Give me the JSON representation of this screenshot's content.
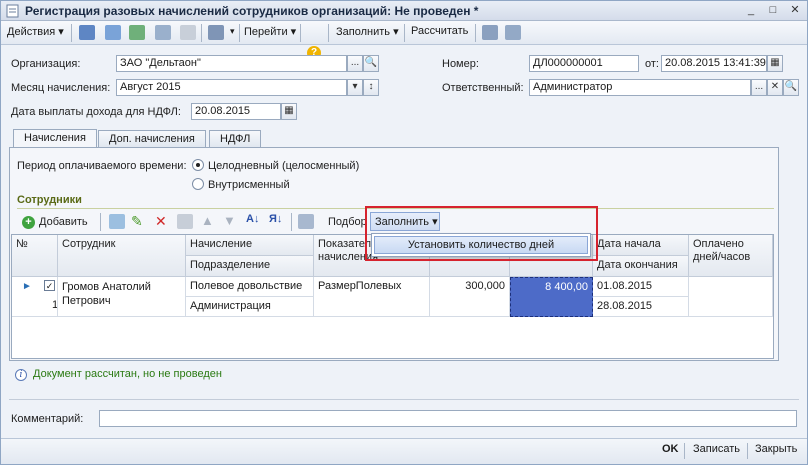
{
  "window": {
    "title": "Регистрация разовых начислений сотрудников организаций: Не проведен *"
  },
  "toolbar": {
    "actions": "Действия",
    "goto": "Перейти",
    "fill": "Заполнить",
    "calculate": "Рассчитать"
  },
  "header": {
    "org_label": "Организация:",
    "org_value": "ЗАО \"Дельтаон\"",
    "number_label": "Номер:",
    "number_value": "ДЛ000000001",
    "date_label": "от:",
    "date_value": "20.08.2015 13:41:39",
    "month_label": "Месяц начисления:",
    "month_value": "Август 2015",
    "responsible_label": "Ответственный:",
    "responsible_value": "Администратор",
    "ndfl_date_label": "Дата выплаты дохода для НДФЛ:",
    "ndfl_date_value": "20.08.2015"
  },
  "tabs": [
    {
      "label": "Начисления"
    },
    {
      "label": "Доп. начисления"
    },
    {
      "label": "НДФЛ"
    }
  ],
  "period": {
    "label": "Период оплачиваемого времени:",
    "option1": "Целодневный (целосменный)",
    "option2": "Внутрисменный"
  },
  "employees": {
    "section_title": "Сотрудники",
    "add_label": "Добавить",
    "pick_label": "Подбор",
    "fill_label": "Заполнить",
    "columns": {
      "no": "№",
      "employee": "Сотрудник",
      "accrual": "Начисление",
      "department": "Подразделение",
      "indicator": "Показатель начисления",
      "date_start": "Дата начала",
      "date_end": "Дата окончания",
      "paid": "Оплачено дней/часов"
    },
    "rows": [
      {
        "no": "1",
        "employee": "Громов Анатолий Петрович",
        "accrual": "Полевое довольствие",
        "department": "Администрация",
        "indicator": "РазмерПолевых",
        "indicator_value": "300,000",
        "result": "8 400,00",
        "date_start": "01.08.2015",
        "date_end": "28.08.2015"
      }
    ]
  },
  "popup": {
    "item": "Установить количество дней"
  },
  "status": {
    "text": "Документ рассчитан, но не проведен"
  },
  "comment": {
    "label": "Комментарий:"
  },
  "footer": {
    "ok": "OK",
    "save": "Записать",
    "close": "Закрыть"
  }
}
